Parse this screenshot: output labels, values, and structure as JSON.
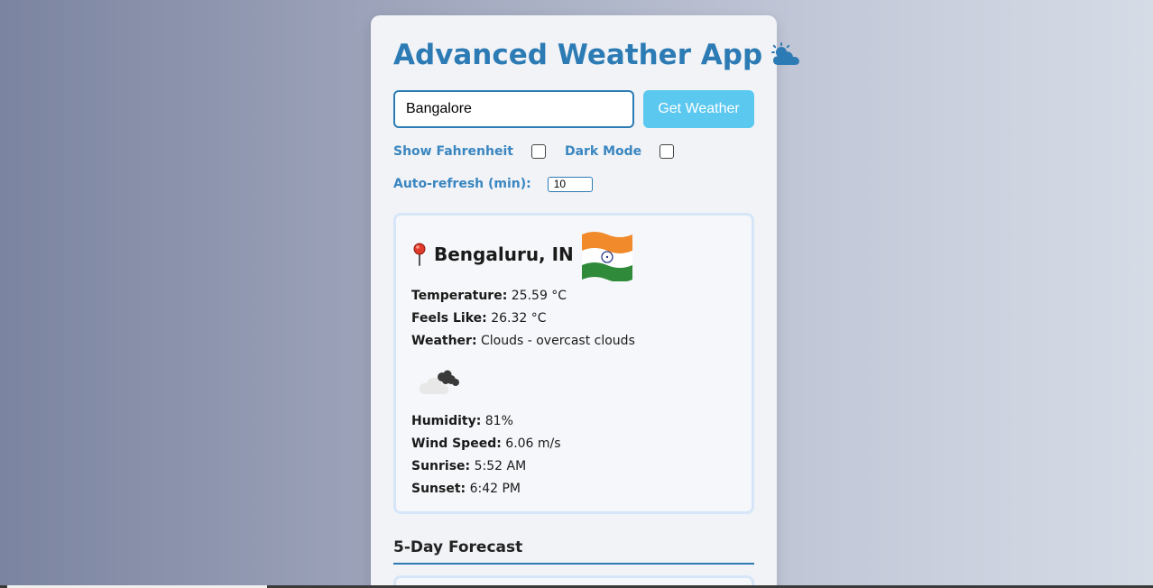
{
  "app": {
    "title": "Advanced Weather App",
    "title_icon": "sun-behind-cloud-icon"
  },
  "search": {
    "value": "Bangalore",
    "button_label": "Get Weather"
  },
  "options": {
    "fahrenheit_label": "Show Fahrenheit",
    "fahrenheit_checked": false,
    "dark_mode_label": "Dark Mode",
    "dark_mode_checked": false,
    "refresh_label": "Auto-refresh (min):",
    "refresh_value": "10"
  },
  "weather": {
    "location": "Bengaluru, IN",
    "location_icon": "round-pushpin-icon",
    "flag": "india-flag-icon",
    "rows_top": [
      {
        "label": "Temperature:",
        "value": "25.59 °C"
      },
      {
        "label": "Feels Like:",
        "value": "26.32 °C"
      },
      {
        "label": "Weather:",
        "value": "Clouds - overcast clouds"
      }
    ],
    "condition_icon": "overcast-clouds-icon",
    "rows_bottom": [
      {
        "label": "Humidity:",
        "value": "81%"
      },
      {
        "label": "Wind Speed:",
        "value": "6.06 m/s"
      },
      {
        "label": "Sunrise:",
        "value": "5:52 AM"
      },
      {
        "label": "Sunset:",
        "value": "6:42 PM"
      }
    ]
  },
  "forecast": {
    "title": "5-Day Forecast"
  },
  "colors": {
    "accent": "#2c7bb4",
    "button": "#5bc8f0",
    "card_border": "#d6e6f8"
  }
}
